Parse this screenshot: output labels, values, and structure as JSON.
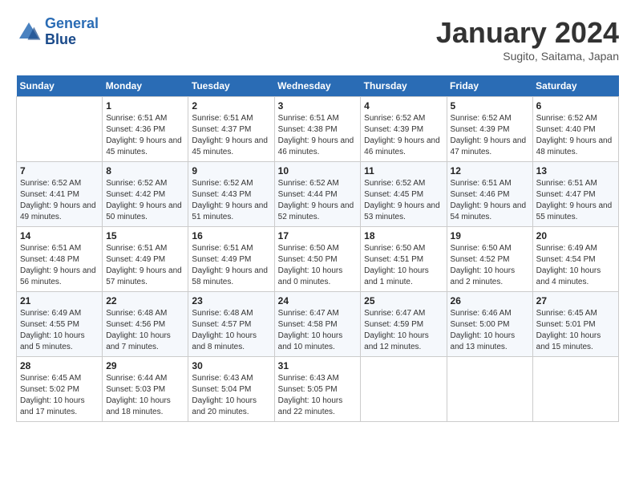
{
  "header": {
    "logo_line1": "General",
    "logo_line2": "Blue",
    "month_title": "January 2024",
    "location": "Sugito, Saitama, Japan"
  },
  "days_of_week": [
    "Sunday",
    "Monday",
    "Tuesday",
    "Wednesday",
    "Thursday",
    "Friday",
    "Saturday"
  ],
  "weeks": [
    [
      {
        "day": "",
        "sunrise": "",
        "sunset": "",
        "daylight": ""
      },
      {
        "day": "1",
        "sunrise": "Sunrise: 6:51 AM",
        "sunset": "Sunset: 4:36 PM",
        "daylight": "Daylight: 9 hours and 45 minutes."
      },
      {
        "day": "2",
        "sunrise": "Sunrise: 6:51 AM",
        "sunset": "Sunset: 4:37 PM",
        "daylight": "Daylight: 9 hours and 45 minutes."
      },
      {
        "day": "3",
        "sunrise": "Sunrise: 6:51 AM",
        "sunset": "Sunset: 4:38 PM",
        "daylight": "Daylight: 9 hours and 46 minutes."
      },
      {
        "day": "4",
        "sunrise": "Sunrise: 6:52 AM",
        "sunset": "Sunset: 4:39 PM",
        "daylight": "Daylight: 9 hours and 46 minutes."
      },
      {
        "day": "5",
        "sunrise": "Sunrise: 6:52 AM",
        "sunset": "Sunset: 4:39 PM",
        "daylight": "Daylight: 9 hours and 47 minutes."
      },
      {
        "day": "6",
        "sunrise": "Sunrise: 6:52 AM",
        "sunset": "Sunset: 4:40 PM",
        "daylight": "Daylight: 9 hours and 48 minutes."
      }
    ],
    [
      {
        "day": "7",
        "sunrise": "Sunrise: 6:52 AM",
        "sunset": "Sunset: 4:41 PM",
        "daylight": "Daylight: 9 hours and 49 minutes."
      },
      {
        "day": "8",
        "sunrise": "Sunrise: 6:52 AM",
        "sunset": "Sunset: 4:42 PM",
        "daylight": "Daylight: 9 hours and 50 minutes."
      },
      {
        "day": "9",
        "sunrise": "Sunrise: 6:52 AM",
        "sunset": "Sunset: 4:43 PM",
        "daylight": "Daylight: 9 hours and 51 minutes."
      },
      {
        "day": "10",
        "sunrise": "Sunrise: 6:52 AM",
        "sunset": "Sunset: 4:44 PM",
        "daylight": "Daylight: 9 hours and 52 minutes."
      },
      {
        "day": "11",
        "sunrise": "Sunrise: 6:52 AM",
        "sunset": "Sunset: 4:45 PM",
        "daylight": "Daylight: 9 hours and 53 minutes."
      },
      {
        "day": "12",
        "sunrise": "Sunrise: 6:51 AM",
        "sunset": "Sunset: 4:46 PM",
        "daylight": "Daylight: 9 hours and 54 minutes."
      },
      {
        "day": "13",
        "sunrise": "Sunrise: 6:51 AM",
        "sunset": "Sunset: 4:47 PM",
        "daylight": "Daylight: 9 hours and 55 minutes."
      }
    ],
    [
      {
        "day": "14",
        "sunrise": "Sunrise: 6:51 AM",
        "sunset": "Sunset: 4:48 PM",
        "daylight": "Daylight: 9 hours and 56 minutes."
      },
      {
        "day": "15",
        "sunrise": "Sunrise: 6:51 AM",
        "sunset": "Sunset: 4:49 PM",
        "daylight": "Daylight: 9 hours and 57 minutes."
      },
      {
        "day": "16",
        "sunrise": "Sunrise: 6:51 AM",
        "sunset": "Sunset: 4:49 PM",
        "daylight": "Daylight: 9 hours and 58 minutes."
      },
      {
        "day": "17",
        "sunrise": "Sunrise: 6:50 AM",
        "sunset": "Sunset: 4:50 PM",
        "daylight": "Daylight: 10 hours and 0 minutes."
      },
      {
        "day": "18",
        "sunrise": "Sunrise: 6:50 AM",
        "sunset": "Sunset: 4:51 PM",
        "daylight": "Daylight: 10 hours and 1 minute."
      },
      {
        "day": "19",
        "sunrise": "Sunrise: 6:50 AM",
        "sunset": "Sunset: 4:52 PM",
        "daylight": "Daylight: 10 hours and 2 minutes."
      },
      {
        "day": "20",
        "sunrise": "Sunrise: 6:49 AM",
        "sunset": "Sunset: 4:54 PM",
        "daylight": "Daylight: 10 hours and 4 minutes."
      }
    ],
    [
      {
        "day": "21",
        "sunrise": "Sunrise: 6:49 AM",
        "sunset": "Sunset: 4:55 PM",
        "daylight": "Daylight: 10 hours and 5 minutes."
      },
      {
        "day": "22",
        "sunrise": "Sunrise: 6:48 AM",
        "sunset": "Sunset: 4:56 PM",
        "daylight": "Daylight: 10 hours and 7 minutes."
      },
      {
        "day": "23",
        "sunrise": "Sunrise: 6:48 AM",
        "sunset": "Sunset: 4:57 PM",
        "daylight": "Daylight: 10 hours and 8 minutes."
      },
      {
        "day": "24",
        "sunrise": "Sunrise: 6:47 AM",
        "sunset": "Sunset: 4:58 PM",
        "daylight": "Daylight: 10 hours and 10 minutes."
      },
      {
        "day": "25",
        "sunrise": "Sunrise: 6:47 AM",
        "sunset": "Sunset: 4:59 PM",
        "daylight": "Daylight: 10 hours and 12 minutes."
      },
      {
        "day": "26",
        "sunrise": "Sunrise: 6:46 AM",
        "sunset": "Sunset: 5:00 PM",
        "daylight": "Daylight: 10 hours and 13 minutes."
      },
      {
        "day": "27",
        "sunrise": "Sunrise: 6:45 AM",
        "sunset": "Sunset: 5:01 PM",
        "daylight": "Daylight: 10 hours and 15 minutes."
      }
    ],
    [
      {
        "day": "28",
        "sunrise": "Sunrise: 6:45 AM",
        "sunset": "Sunset: 5:02 PM",
        "daylight": "Daylight: 10 hours and 17 minutes."
      },
      {
        "day": "29",
        "sunrise": "Sunrise: 6:44 AM",
        "sunset": "Sunset: 5:03 PM",
        "daylight": "Daylight: 10 hours and 18 minutes."
      },
      {
        "day": "30",
        "sunrise": "Sunrise: 6:43 AM",
        "sunset": "Sunset: 5:04 PM",
        "daylight": "Daylight: 10 hours and 20 minutes."
      },
      {
        "day": "31",
        "sunrise": "Sunrise: 6:43 AM",
        "sunset": "Sunset: 5:05 PM",
        "daylight": "Daylight: 10 hours and 22 minutes."
      },
      {
        "day": "",
        "sunrise": "",
        "sunset": "",
        "daylight": ""
      },
      {
        "day": "",
        "sunrise": "",
        "sunset": "",
        "daylight": ""
      },
      {
        "day": "",
        "sunrise": "",
        "sunset": "",
        "daylight": ""
      }
    ]
  ]
}
